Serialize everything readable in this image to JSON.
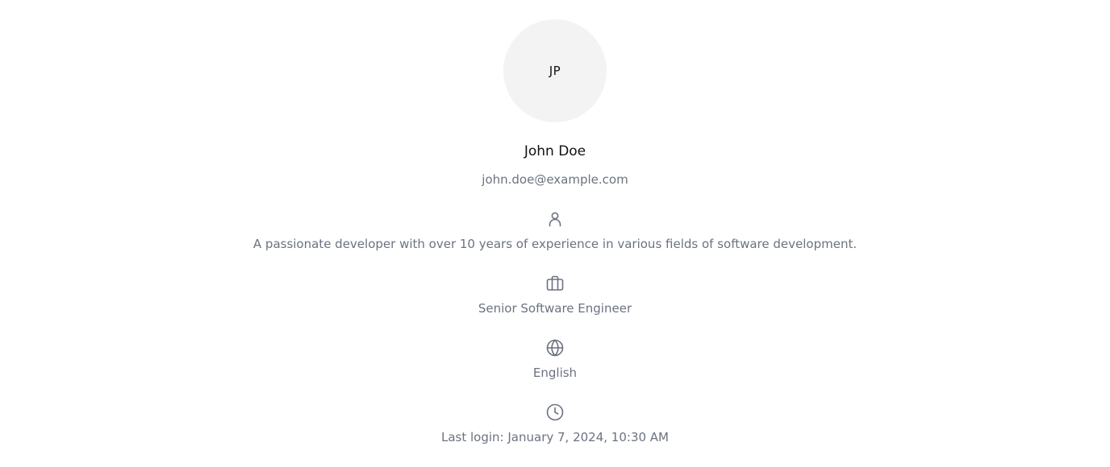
{
  "profile": {
    "initials": "JP",
    "name": "John Doe",
    "email": "john.doe@example.com",
    "bio": "A passionate developer with over 10 years of experience in various fields of software development.",
    "job_title": "Senior Software Engineer",
    "language": "English",
    "last_login": "Last login: January 7, 2024, 10:30 AM"
  },
  "icons": {
    "bio": "user-icon",
    "job_title": "briefcase-icon",
    "language": "globe-icon",
    "last_login": "clock-icon"
  },
  "colors": {
    "avatar_bg": "#f3f3f3",
    "text_primary": "#111111",
    "text_muted": "#6b7280"
  }
}
